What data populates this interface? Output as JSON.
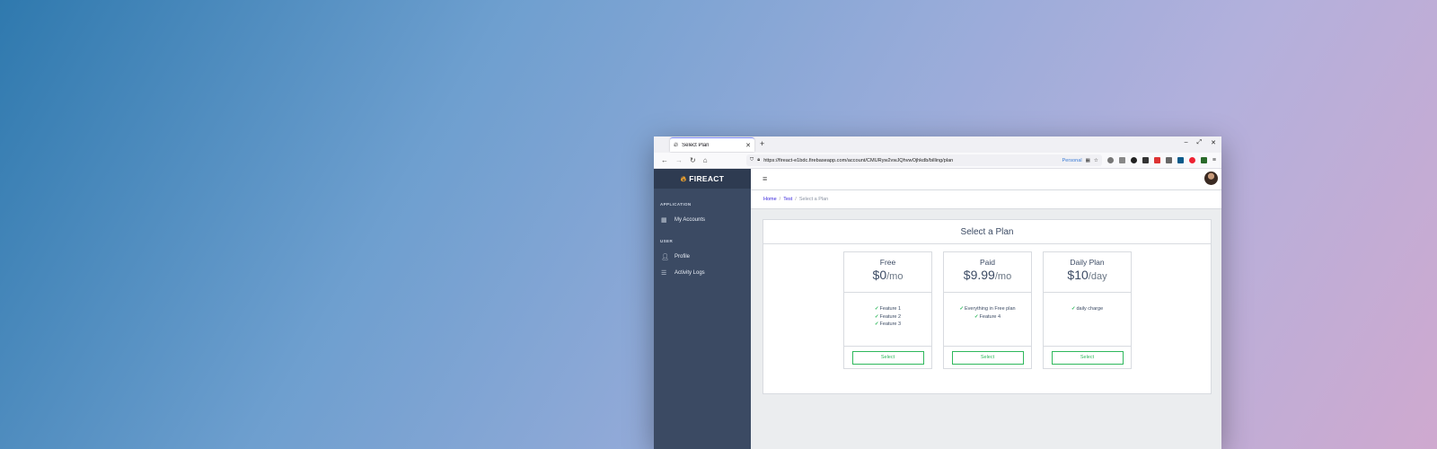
{
  "browser": {
    "tab_title": "Select Plan",
    "new_tab": "+",
    "window_controls": [
      "–",
      "⤢",
      "✕"
    ],
    "url": "https://fireact-e1bdc.firebaseapp.com/account/CMURyw2vwJQhvwOjhkdb/billing/plan",
    "persona": "Personal"
  },
  "sidebar": {
    "brand": "FIREACT",
    "sections": [
      {
        "title": "APPLICATION",
        "items": [
          {
            "label": "My Accounts",
            "icon": "grid-icon"
          }
        ]
      },
      {
        "title": "USER",
        "items": [
          {
            "label": "Profile",
            "icon": "user-icon"
          },
          {
            "label": "Activity Logs",
            "icon": "list-icon"
          }
        ]
      }
    ]
  },
  "breadcrumb": {
    "home": "Home",
    "test": "Test",
    "current": "Select a Plan"
  },
  "card": {
    "title": "Select a Plan"
  },
  "plans": [
    {
      "name": "Free",
      "price": "$0",
      "unit": "/mo",
      "features": [
        "Feature 1",
        "Feature 2",
        "Feature 3"
      ],
      "button": "Select"
    },
    {
      "name": "Paid",
      "price": "$9.99",
      "unit": "/mo",
      "features": [
        "Everything in Free plan",
        "Feature 4"
      ],
      "button": "Select"
    },
    {
      "name": "Daily Plan",
      "price": "$10",
      "unit": "/day",
      "features": [
        "daily charge"
      ],
      "button": "Select"
    }
  ],
  "colors": {
    "sidebar": "#3b4a63",
    "accent": "#321fdb",
    "success": "#2eb85c"
  }
}
